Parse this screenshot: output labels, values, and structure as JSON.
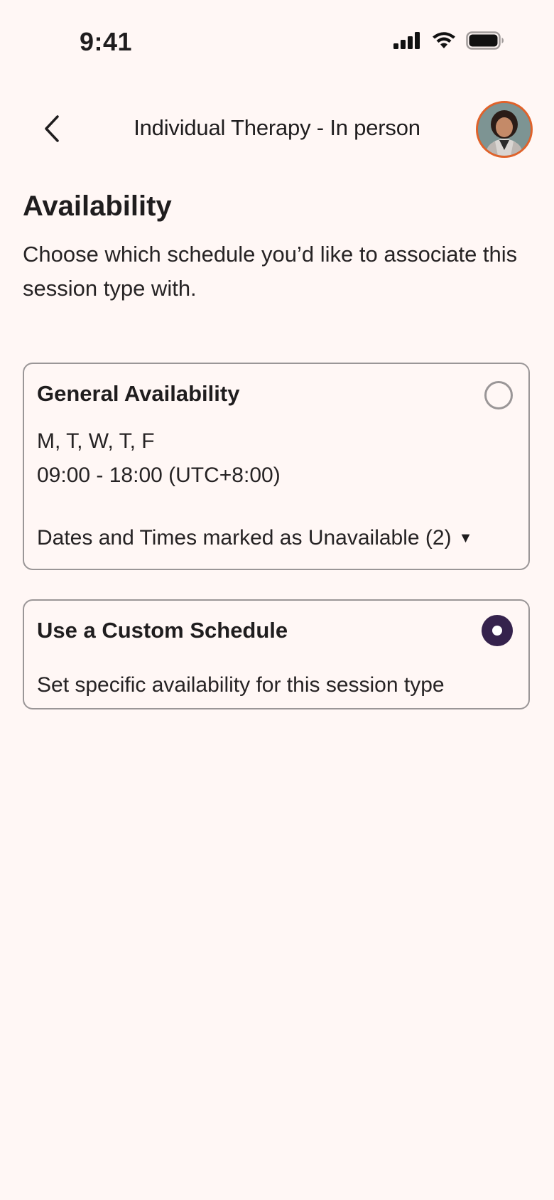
{
  "status_bar": {
    "time": "9:41",
    "icons": [
      "cellular-signal-icon",
      "wifi-icon",
      "battery-icon"
    ]
  },
  "header": {
    "back_icon": "chevron-left-icon",
    "title": "Individual Therapy - In person",
    "avatar": "profile-avatar"
  },
  "availability": {
    "title": "Availability",
    "description": "Choose which schedule you’d like to associate this session type with."
  },
  "options": {
    "general": {
      "title": "General Availability",
      "days": "M, T, W, T, F",
      "hours": "09:00 - 18:00 (UTC+8:00)",
      "unavailable_label": "Dates and Times marked as Unavailable (2)",
      "caret": "▼",
      "selected": false
    },
    "custom": {
      "title": "Use a Custom Schedule",
      "description": "Set specific availability for this session type",
      "selected": true
    }
  },
  "colors": {
    "background": "#fff7f5",
    "radio_selected": "#35224c",
    "avatar_border": "#e0622a",
    "card_border": "#9a9697"
  }
}
